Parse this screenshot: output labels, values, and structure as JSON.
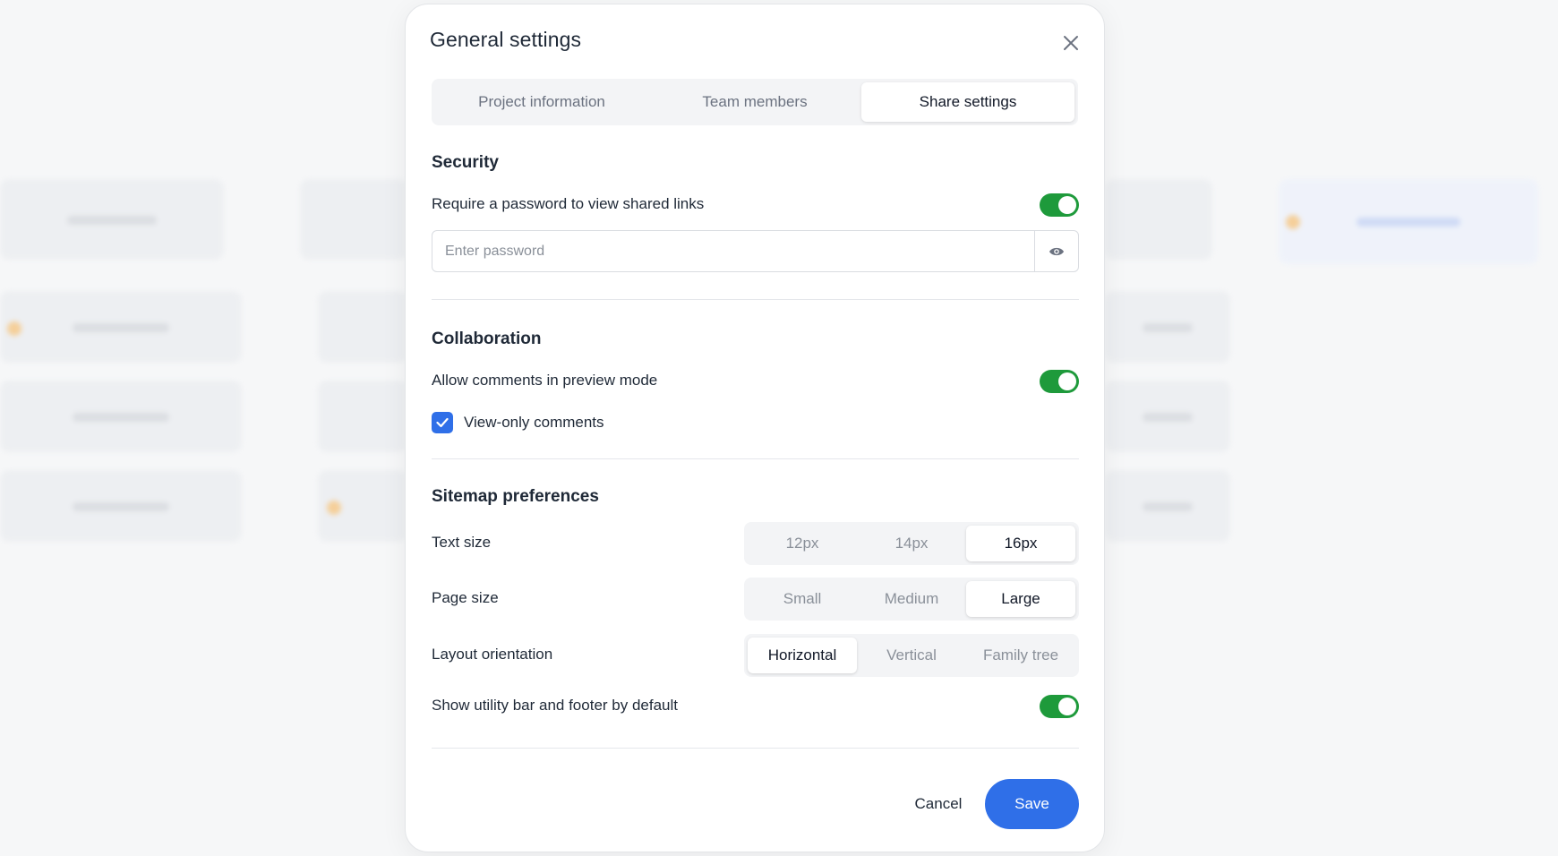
{
  "dialog": {
    "title": "General settings",
    "close_icon": "close-icon"
  },
  "tabs": [
    {
      "label": "Project information",
      "active": false
    },
    {
      "label": "Team members",
      "active": false
    },
    {
      "label": "Share settings",
      "active": true
    }
  ],
  "security": {
    "title": "Security",
    "require_password_label": "Require a password to view shared links",
    "require_password_enabled": true,
    "password_value": "",
    "password_placeholder": "Enter password",
    "reveal_icon": "eye-icon"
  },
  "collaboration": {
    "title": "Collaboration",
    "allow_comments_label": "Allow comments in preview mode",
    "allow_comments_enabled": true,
    "view_only_label": "View-only comments",
    "view_only_checked": true
  },
  "sitemap": {
    "title": "Sitemap preferences",
    "text_size": {
      "label": "Text size",
      "options": [
        "12px",
        "14px",
        "16px"
      ],
      "selected": "16px"
    },
    "page_size": {
      "label": "Page size",
      "options": [
        "Small",
        "Medium",
        "Large"
      ],
      "selected": "Large"
    },
    "layout_orientation": {
      "label": "Layout orientation",
      "options": [
        "Horizontal",
        "Vertical",
        "Family tree"
      ],
      "selected": "Horizontal"
    },
    "utility_bar_label": "Show utility bar and footer by default",
    "utility_bar_enabled": true
  },
  "footer": {
    "cancel_label": "Cancel",
    "save_label": "Save"
  },
  "colors": {
    "toggle_on": "#1e9a3b",
    "primary": "#2f6fe8"
  }
}
